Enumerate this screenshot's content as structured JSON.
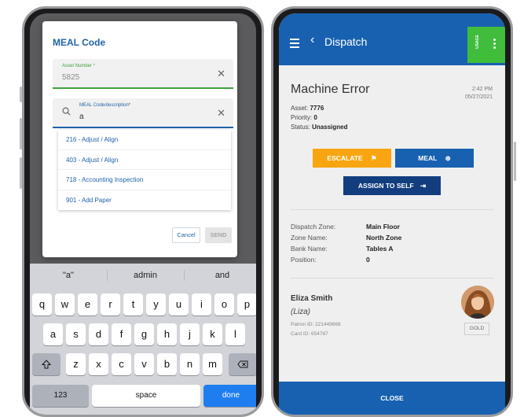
{
  "left_phone": {
    "dialog": {
      "title": "MEAL Code",
      "asset_field": {
        "label": "Asset Number *",
        "value": "5825"
      },
      "meal_field": {
        "label": "MEAL Code/description*",
        "value": "a"
      },
      "options": [
        "216 - Adjust / Align",
        "403 - Adjust / Align",
        "718 - Accounting Inspection",
        "901 - Add Paper"
      ],
      "cancel_label": "Cancel",
      "send_label": "SEND"
    },
    "keyboard": {
      "suggestions": [
        "\"a\"",
        "admin",
        "and"
      ],
      "row1": [
        "q",
        "w",
        "e",
        "r",
        "t",
        "y",
        "u",
        "i",
        "o",
        "p"
      ],
      "row2": [
        "a",
        "s",
        "d",
        "f",
        "g",
        "h",
        "j",
        "k",
        "l"
      ],
      "row3": [
        "z",
        "x",
        "c",
        "v",
        "b",
        "n",
        "m"
      ],
      "numbers_label": "123",
      "space_label": "space",
      "done_label": "done"
    }
  },
  "right_phone": {
    "header": {
      "title": "Dispatch",
      "usage_label": "USAGE"
    },
    "error": {
      "title": "Machine Error",
      "time": "2:42 PM",
      "date": "05/27/2021",
      "asset_label": "Asset:",
      "asset_value": "7776",
      "priority_label": "Priority:",
      "priority_value": "0",
      "status_label": "Status:",
      "status_value": "Unassigned"
    },
    "actions": {
      "escalate_label": "ESCALATE",
      "meal_label": "MEAL",
      "assign_label": "ASSIGN TO SELF"
    },
    "zone_info": [
      {
        "label": "Dispatch Zone:",
        "value": "Main Floor"
      },
      {
        "label": "Zone Name:",
        "value": "North Zone"
      },
      {
        "label": "Bank Name:",
        "value": "Tables A"
      },
      {
        "label": "Position:",
        "value": "0"
      }
    ],
    "patron": {
      "name": "Eliza Smith",
      "nickname": "(Liza)",
      "patron_id": "Patron ID: 221449668",
      "card_id": "Card ID: 654787",
      "tier": "GOLD"
    },
    "close_label": "CLOSE"
  },
  "colors": {
    "primary_blue": "#1861b0",
    "dark_blue": "#123e80",
    "escalate_orange": "#f8a511",
    "usage_green": "#3fbd3b",
    "done_blue": "#1e7ef0"
  }
}
